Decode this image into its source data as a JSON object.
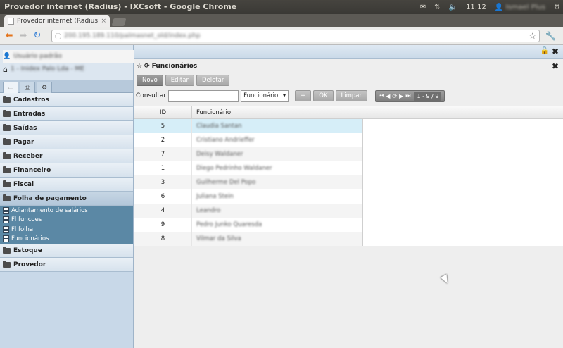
{
  "window": {
    "title": "Provedor internet (Radius) - IXCsoft - Google Chrome",
    "clock": "11:12",
    "username": "Ismael Plus"
  },
  "browser": {
    "tab_title": "Provedor internet (Radius",
    "tab_close": "×",
    "url": "200.195.189.110/palmasnet_old/index.php"
  },
  "sidebar": {
    "user_name": "Usuário padrão",
    "company": "1 - Inidex Palo Lda - ME",
    "tabs": [
      "window-icon",
      "print-icon",
      "gear-icon"
    ],
    "menu": [
      {
        "label": "Cadastros"
      },
      {
        "label": "Entradas"
      },
      {
        "label": "Saídas"
      },
      {
        "label": "Pagar"
      },
      {
        "label": "Receber"
      },
      {
        "label": "Financeiro"
      },
      {
        "label": "Fiscal"
      },
      {
        "label": "Folha de pagamento"
      }
    ],
    "submenu": [
      "Adiantamento de salários",
      "Fl funcoes",
      "Fl folha",
      "Funcionários"
    ],
    "menu_after": [
      {
        "label": "Estoque"
      },
      {
        "label": "Provedor"
      }
    ]
  },
  "panel": {
    "title": "Funcionários",
    "buttons": {
      "novo": "Novo",
      "editar": "Editar",
      "deletar": "Deletar"
    },
    "search_label": "Consultar",
    "search_value": "",
    "field_select": "Funcionário",
    "btn_plus": "+",
    "btn_ok": "OK",
    "btn_limpar": "Limpar",
    "pager_count": "1 - 9 / 9"
  },
  "grid": {
    "columns": {
      "id": "ID",
      "name": "Funcionário"
    },
    "rows": [
      {
        "id": "5",
        "name": "Claudia Santan"
      },
      {
        "id": "2",
        "name": "Cristiano Andrieffer"
      },
      {
        "id": "7",
        "name": "Deisy Waldaner"
      },
      {
        "id": "1",
        "name": "Diego Pedrinho Waldaner"
      },
      {
        "id": "3",
        "name": "Guilherme Del Popo"
      },
      {
        "id": "6",
        "name": "Juliana Stein"
      },
      {
        "id": "4",
        "name": "Leandro"
      },
      {
        "id": "9",
        "name": "Pedro Junko Quaresda"
      },
      {
        "id": "8",
        "name": "Vilmar da Silva"
      }
    ]
  }
}
